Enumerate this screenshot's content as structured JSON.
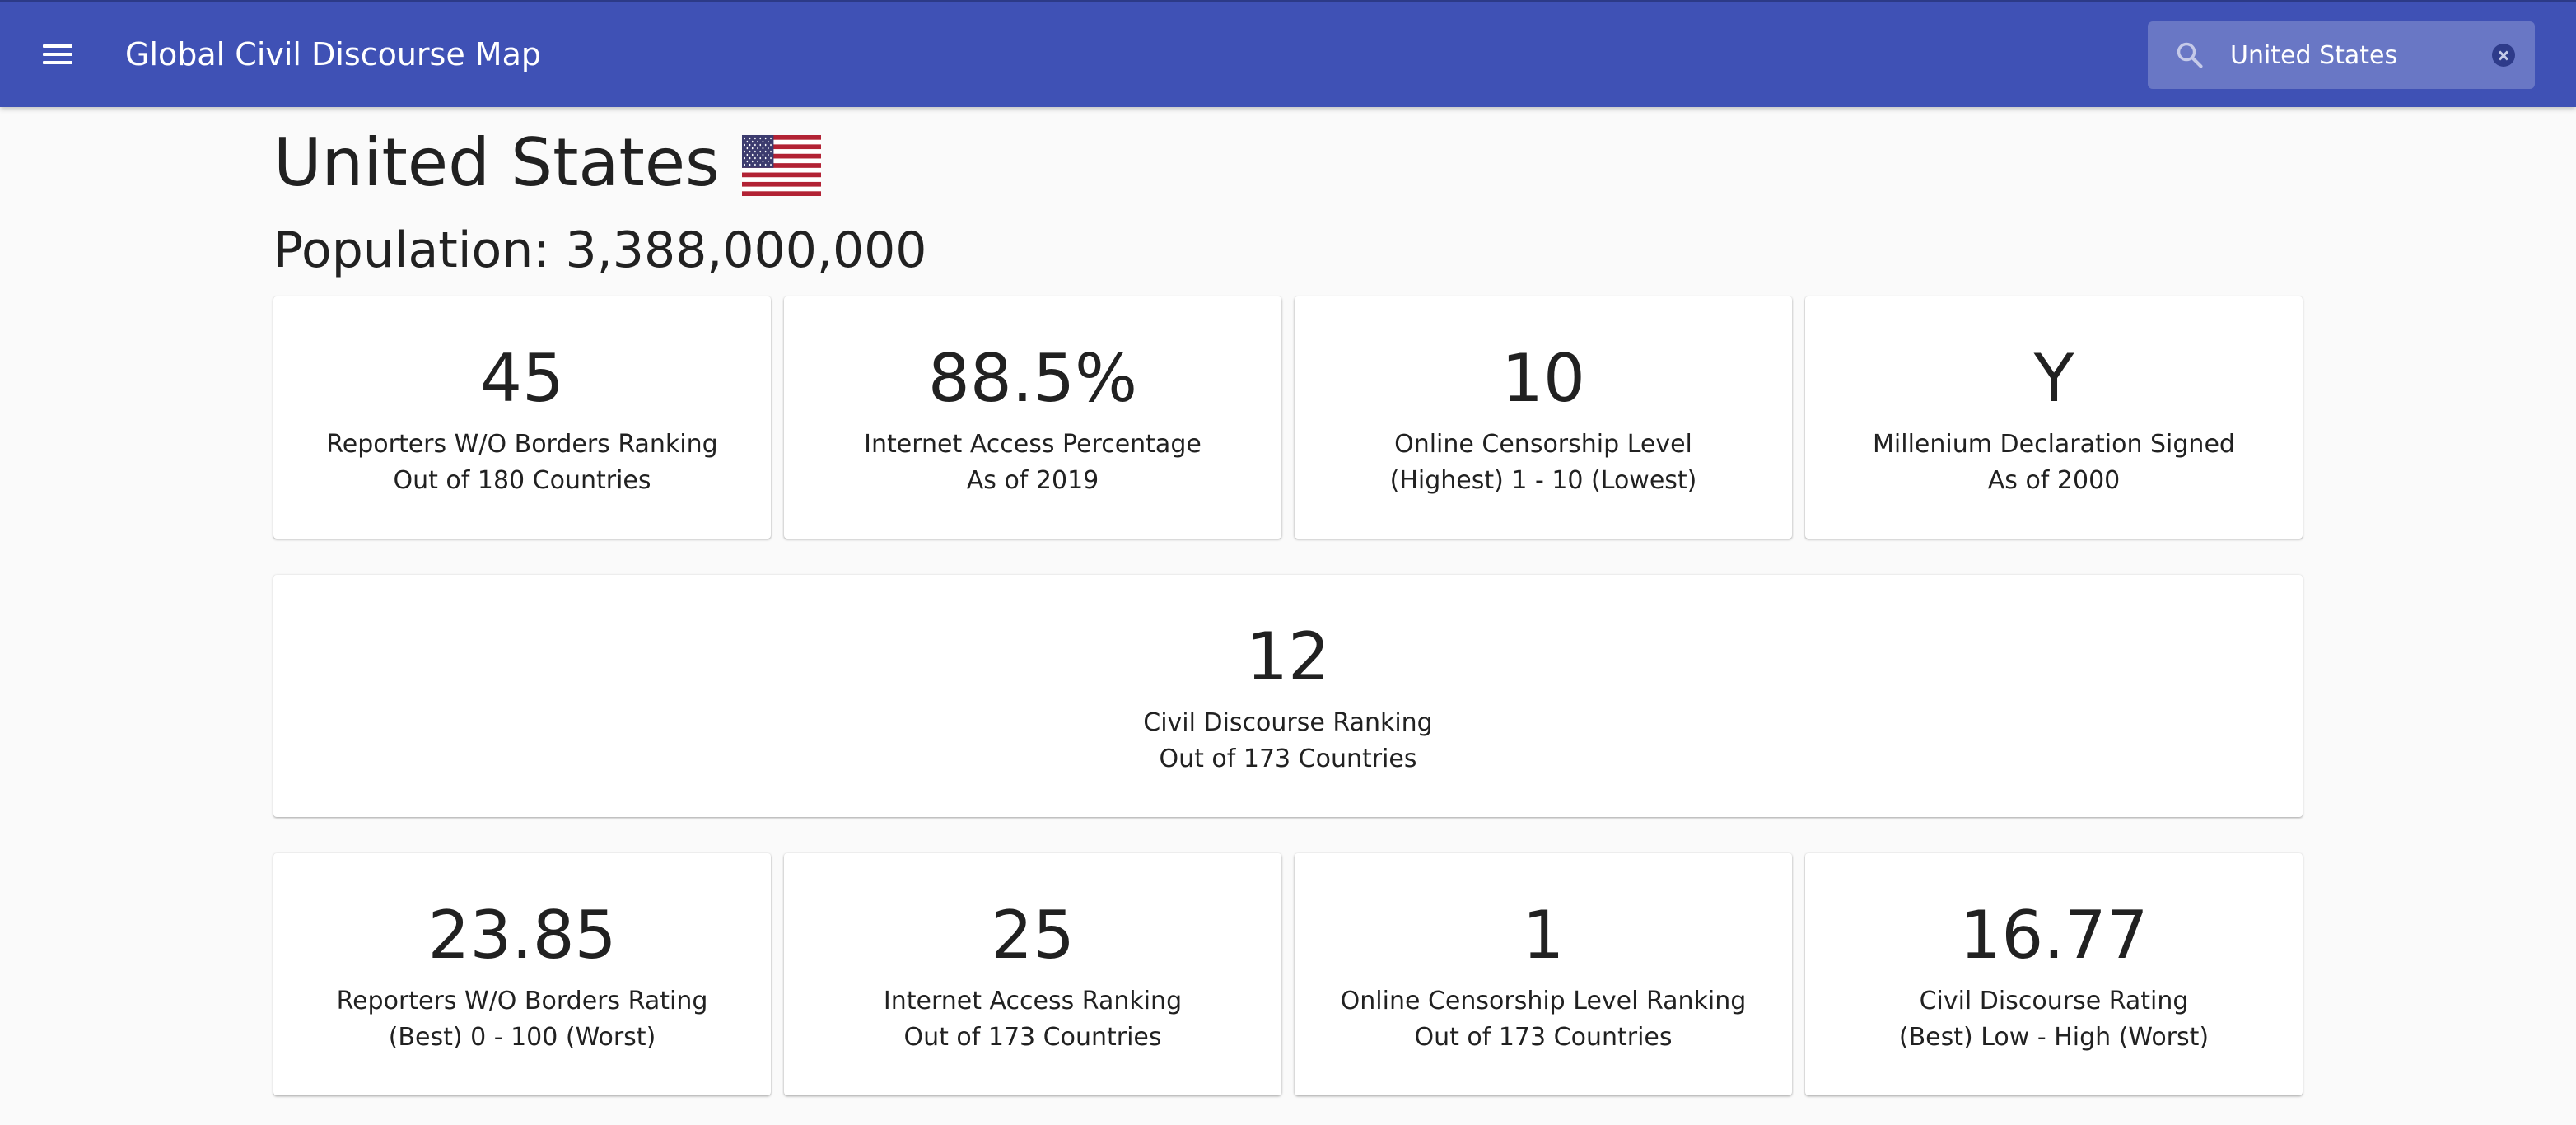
{
  "header": {
    "title": "Global Civil Discourse Map",
    "search_value": "United States",
    "search_placeholder": "Search",
    "icons": {
      "menu": "menu-icon",
      "search": "search-icon",
      "clear": "clear-icon"
    },
    "colors": {
      "appbar": "#3f51b5"
    }
  },
  "country": {
    "name": "United States",
    "flag": "us-flag",
    "population_label": "Population: 3,388,000,000"
  },
  "stats_row1": [
    {
      "value": "45",
      "label": "Reporters W/O Borders Ranking",
      "sublabel": "Out of 180 Countries"
    },
    {
      "value": "88.5%",
      "label": "Internet Access Percentage",
      "sublabel": "As of 2019"
    },
    {
      "value": "10",
      "label": "Online Censorship Level",
      "sublabel": "(Highest) 1 - 10 (Lowest)"
    },
    {
      "value": "Y",
      "label": "Millenium Declaration Signed",
      "sublabel": "As of 2000"
    }
  ],
  "main_stat": {
    "value": "12",
    "label": "Civil Discourse Ranking",
    "sublabel": "Out of 173 Countries"
  },
  "stats_row2": [
    {
      "value": "23.85",
      "label": "Reporters W/O Borders Rating",
      "sublabel": "(Best) 0 - 100 (Worst)"
    },
    {
      "value": "25",
      "label": "Internet Access Ranking",
      "sublabel": "Out of 173 Countries"
    },
    {
      "value": "1",
      "label": "Online Censorship Level Ranking",
      "sublabel": "Out of 173 Countries"
    },
    {
      "value": "16.77",
      "label": "Civil Discourse Rating",
      "sublabel": "(Best) Low - High (Worst)"
    }
  ]
}
